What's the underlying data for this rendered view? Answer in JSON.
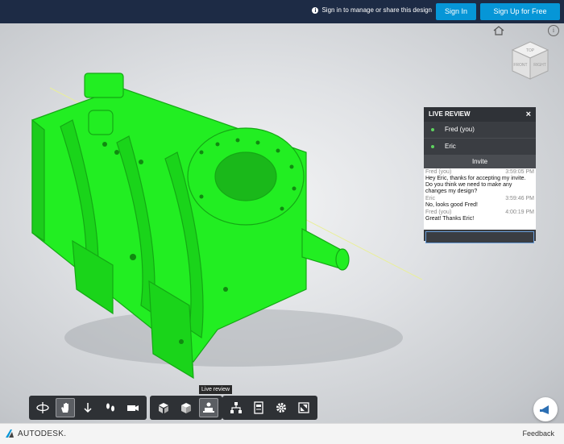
{
  "topbar": {
    "message": "Sign in to manage or share this design",
    "signin_label": "Sign In",
    "signup_label": "Sign Up for Free"
  },
  "viewcube": {
    "top_face": "TOP",
    "front_face": "FRONT",
    "right_face": "RIGHT"
  },
  "live_review": {
    "title": "LIVE REVIEW",
    "close": "×",
    "users": [
      {
        "name": "Fred (you)"
      },
      {
        "name": "Eric"
      }
    ],
    "invite_label": "Invite",
    "messages": [
      {
        "author": "Fred (you)",
        "time": "3:59:05 PM",
        "text": "Hey Eric, thanks for accepting my invite. Do you think we need to make any changes my design?"
      },
      {
        "author": "Eric",
        "time": "3:59:46 PM",
        "text": "No, looks good Fred!"
      },
      {
        "author": "Fred (you)",
        "time": "4:00:19 PM",
        "text": "Great! Thanks Eric!"
      }
    ]
  },
  "tooltip": "Live review",
  "toolbar": {
    "icons": [
      "orbit-icon",
      "pan-icon",
      "dolly-icon",
      "walk-icon",
      "camera-icon",
      "explode-icon",
      "section-icon",
      "live-review-icon",
      "model-browser-icon",
      "properties-icon",
      "settings-icon",
      "fullscreen-icon"
    ]
  },
  "footer": {
    "brand": "AUTODESK.",
    "feedback": "Feedback"
  },
  "colors": {
    "topbar": "#1d2b45",
    "accent": "#0696d7",
    "model": "#22ee22"
  }
}
